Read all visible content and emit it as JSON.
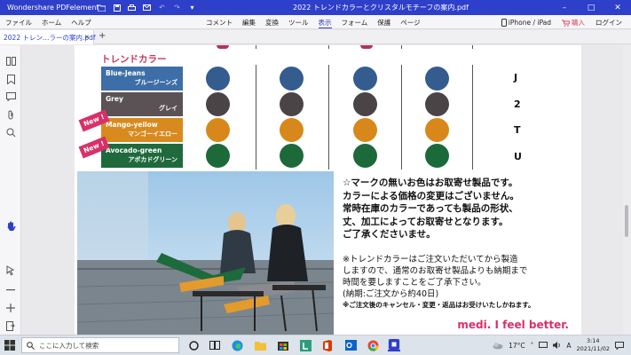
{
  "titlebar": {
    "app_name": "Wondershare PDFelement",
    "doc_title": "2022 トレンドカラーとクリスタルモチーフの案内.pdf",
    "icons": [
      "folder-icon",
      "save-icon",
      "print-icon",
      "mail-icon",
      "undo-icon",
      "redo-icon",
      "dropdown-icon"
    ],
    "window_buttons": [
      "minimize-icon",
      "maximize-icon",
      "close-icon"
    ]
  },
  "menu": {
    "left": [
      "ファイル",
      "ホーム",
      "ヘルプ"
    ],
    "mid": [
      "コメント",
      "編集",
      "変換",
      "ツール",
      "表示",
      "フォーム",
      "保護",
      "ページ"
    ],
    "active": "表示",
    "device": "iPhone / iPad",
    "buy": "購入",
    "login": "ログイン"
  },
  "tab": {
    "label": "2022 トレン…ラーの案内.pdf",
    "close": "×",
    "add": "+"
  },
  "page": {
    "section_title": "トレンドカラー",
    "rows": [
      {
        "en": "Blue-Jeans",
        "jp": "ブルージーンズ",
        "bg": "#3e6ea8",
        "dot": "#355c8f",
        "code": "J",
        "new": false
      },
      {
        "en": "Grey",
        "jp": "グレイ",
        "bg": "#5a5254",
        "dot": "#4a4446",
        "code": "2",
        "new": false
      },
      {
        "en": "Mango-yellow",
        "jp": "マンゴーイエロー",
        "bg": "#d88a1e",
        "dot": "#d8881a",
        "code": "T",
        "new": true
      },
      {
        "en": "Avocado-green",
        "jp": "アボカドグリーン",
        "bg": "#1f6a3c",
        "dot": "#1c6a3a",
        "code": "U",
        "new": true
      }
    ],
    "new_label": "New !",
    "notice_lines": [
      "☆マークの無いお色はお取寄せ製品です。",
      "カラーによる価格の変更はございません。",
      "常時在庫のカラーであっても製品の形状、",
      "丈、加工によってお取寄せとなります。",
      "ご了承くださいませ。"
    ],
    "notice2_lines": [
      "※トレンドカラーはご注文いただいてから製造",
      "しますので、通常のお取寄せ製品よりも納期まで",
      "時間を要しますことをご了承下さい。",
      "(納期:ご注文から約40日)"
    ],
    "notice3": "※ご注文後のキャンセル・変更・返品はお受けいたしかねます。",
    "brand": "medi. I feel better."
  },
  "taskbar": {
    "search_placeholder": "ここに入力して検索",
    "weather": "17°C",
    "time": "3:14",
    "date": "2021/11/02",
    "lang": "A"
  },
  "colors": {
    "accent": "#2e3fc9",
    "pink": "#d8306a"
  }
}
